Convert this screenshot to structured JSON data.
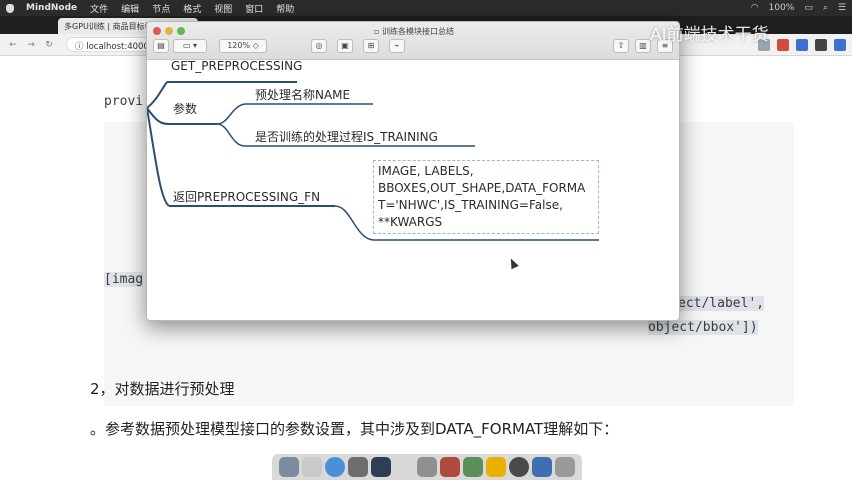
{
  "menubar": {
    "app": "MindNode",
    "items": [
      "文件",
      "编辑",
      "节点",
      "格式",
      "视图",
      "窗口",
      "帮助"
    ],
    "battery": "100%"
  },
  "browser": {
    "tabs": [
      {
        "label": "多GPU训练 | 商品目标检测项目"
      },
      {
        "label": ""
      }
    ],
    "address": "localhost:4000/"
  },
  "mindnode": {
    "window_title": "训练各模块接口总结",
    "zoom": "120%",
    "nodes": {
      "get_pre": "GET_PREPROCESSING",
      "params": "参数",
      "param_name": "预处理名称NAME",
      "param_training": "是否训练的处理过程IS_TRAINING",
      "returns": "返回PREPROCESSING_FN",
      "ret_lines": [
        "IMAGE, LABELS,",
        "BBOXES,OUT_SHAPE,DATA_FORMA",
        "T='NHWC',IS_TRAINING=False,",
        "**KWARGS"
      ]
    }
  },
  "doc": {
    "code_top": "provi",
    "code_image": "[imag",
    "code_tail1": "ect/label',",
    "code_tail2": "object/bbox'])",
    "heading": "2，对数据进行预处理",
    "paragraph": "。参考数据预处理模型接口的参数设置，其中涉及到DATA_FORMAT理解如下："
  },
  "watermark": "AI前端技术干货"
}
